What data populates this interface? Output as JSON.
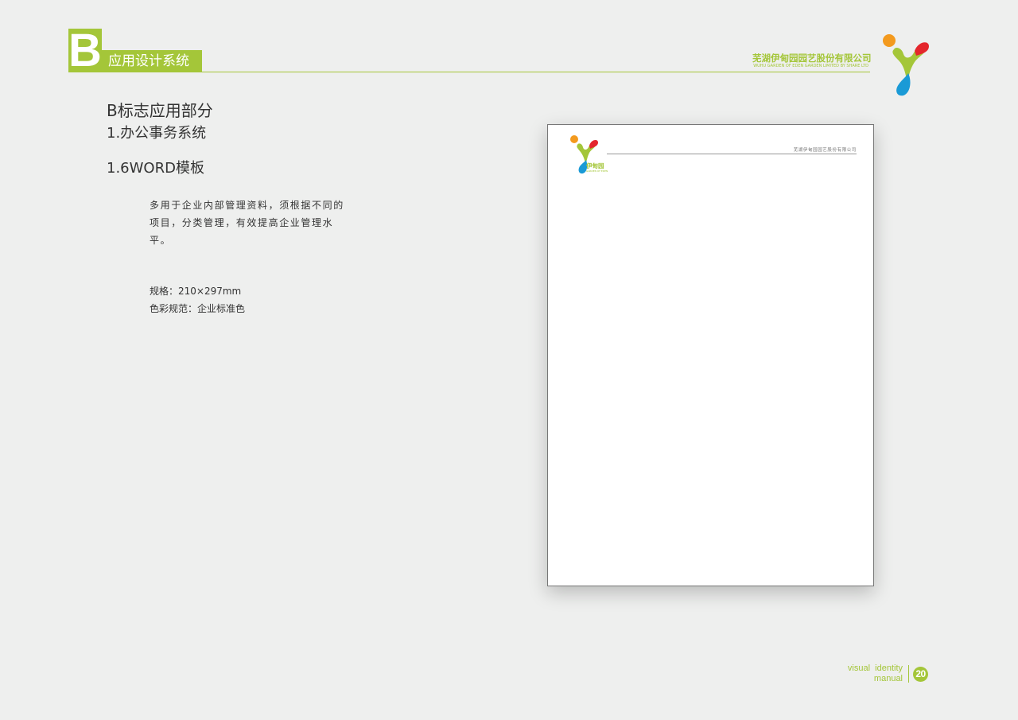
{
  "header": {
    "letter": "B",
    "band_title": "应用设计系统",
    "company_cn": "芜湖伊甸园园艺股份有限公司",
    "company_en": "WUHU GARDEN OF EDEN GARDEN LIMITED BY SHARE LTD",
    "logo": "garden-logo-icon"
  },
  "content": {
    "section_title": "B标志应用部分",
    "subsection_title": "1.办公事务系统",
    "item_title": "1.6WORD模板",
    "description": "多用于企业内部管理资料，须根据不同的项目，分类管理，有效提高企业管理水平。",
    "spec_size": "规格：210×297mm",
    "spec_color": "色彩规范：企业标准色"
  },
  "sheet": {
    "company": "芜湖伊甸园园艺股份有限公司",
    "brand_text": "伊甸园",
    "brand_en": "GARDEN OF EDEN"
  },
  "footer": {
    "line1": "visual  identity",
    "line2": "manual",
    "page_number": "20"
  },
  "colors": {
    "accent_green": "#a4c639",
    "logo_orange": "#f39a1e",
    "logo_red": "#e4262c",
    "logo_blue": "#1a9ad6",
    "background": "#eeefee"
  }
}
